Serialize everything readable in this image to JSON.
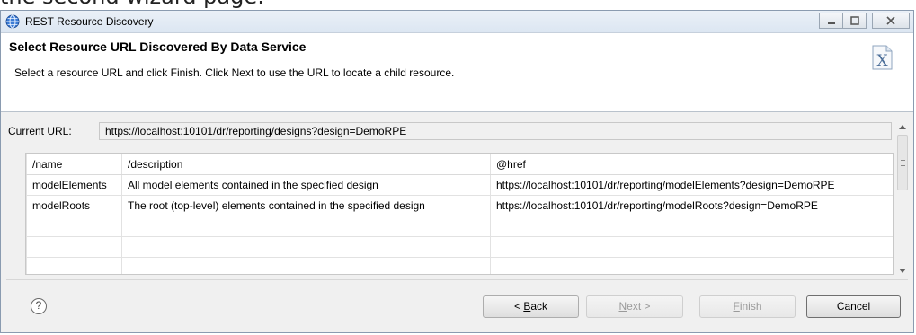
{
  "caption": "the second wizard page:",
  "window": {
    "title": "REST Resource Discovery",
    "controls": [
      "minimize",
      "maximize",
      "close"
    ]
  },
  "header": {
    "title": "Select Resource URL Discovered By Data Service",
    "description": "Select a resource URL and click Finish. Click Next to use the URL to locate a child resource.",
    "image_icon": "xml-document-icon"
  },
  "current_url": {
    "label": "Current URL:",
    "value": "https://localhost:10101/dr/reporting/designs?design=DemoRPE"
  },
  "table": {
    "columns": [
      "/name",
      "/description",
      "@href"
    ],
    "rows": [
      [
        "modelElements",
        "All model elements contained in the specified design",
        "https://localhost:10101/dr/reporting/modelElements?design=DemoRPE"
      ],
      [
        "modelRoots",
        "The root (top-level) elements contained in the specified design",
        "https://localhost:10101/dr/reporting/modelRoots?design=DemoRPE"
      ]
    ]
  },
  "buttons": {
    "help": "?",
    "back_prefix": "< ",
    "back_mnemonic": "B",
    "back_rest": "ack",
    "next_mnemonic": "N",
    "next_rest": "ext >",
    "finish_mnemonic": "F",
    "finish_rest": "inish",
    "cancel": "Cancel"
  }
}
